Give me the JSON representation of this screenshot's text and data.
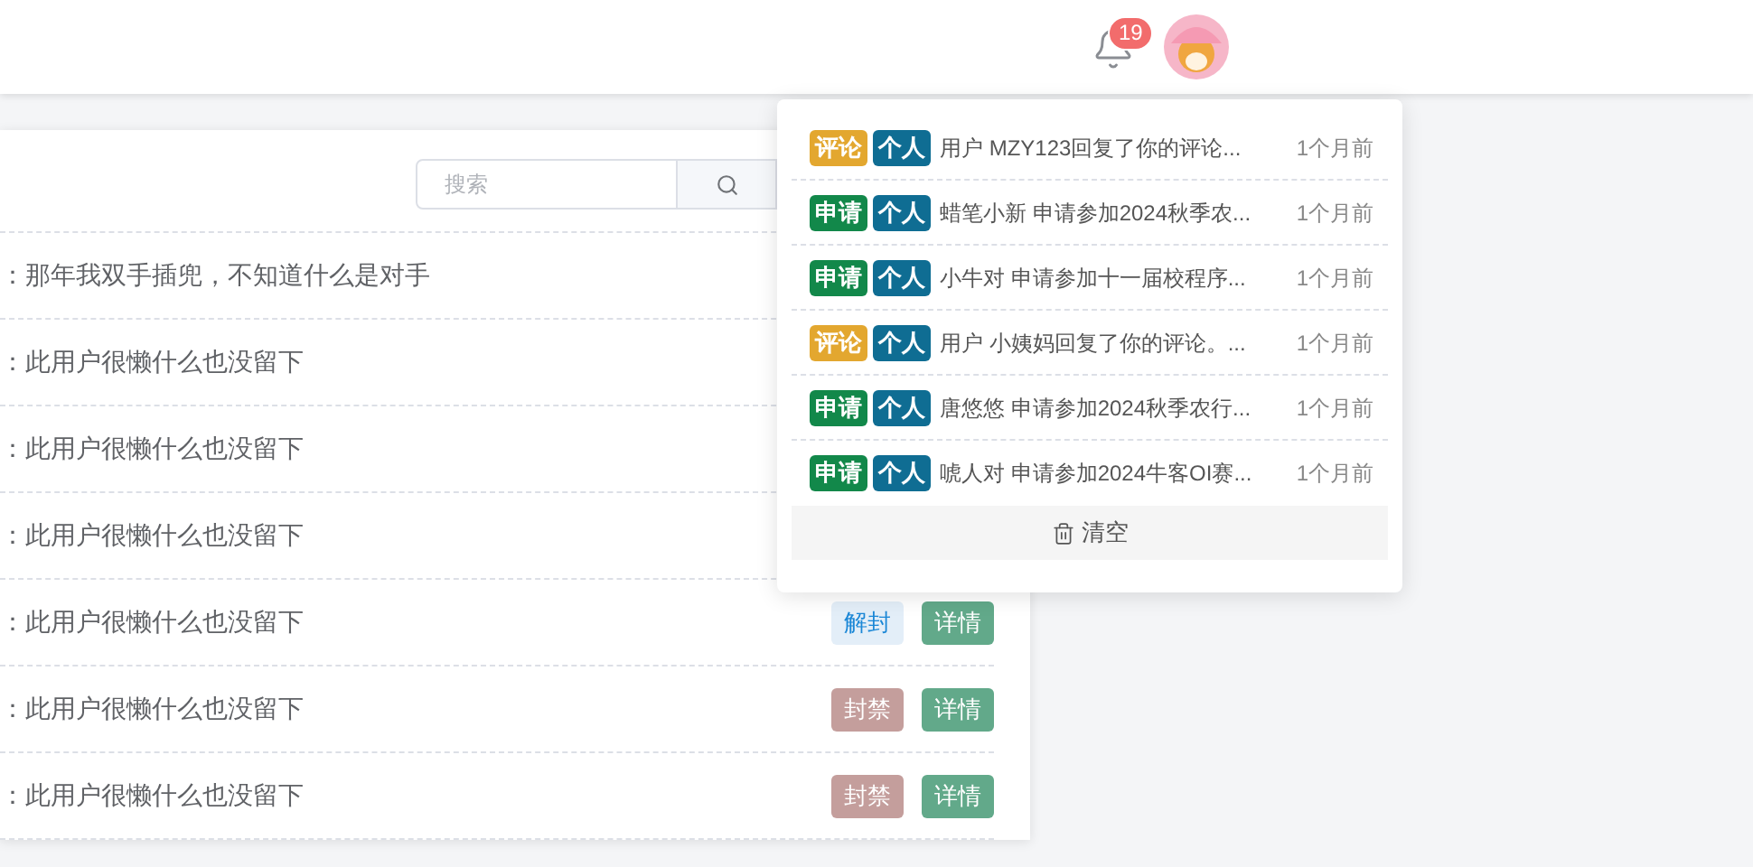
{
  "header": {
    "notification_count": "19"
  },
  "search": {
    "placeholder": "搜索"
  },
  "rows": [
    {
      "bio": "：那年我双手插兜，不知道什么是对手",
      "actions": []
    },
    {
      "bio": "：此用户很懒什么也没留下",
      "actions": []
    },
    {
      "bio": "：此用户很懒什么也没留下",
      "actions": []
    },
    {
      "bio": "：此用户很懒什么也没留下",
      "actions": []
    },
    {
      "bio": "：此用户很懒什么也没留下",
      "actions": [
        {
          "label": "解封",
          "kind": "unban"
        },
        {
          "label": "详情",
          "kind": "detail"
        }
      ]
    },
    {
      "bio": "：此用户很懒什么也没留下",
      "actions": [
        {
          "label": "封禁",
          "kind": "ban"
        },
        {
          "label": "详情",
          "kind": "detail"
        }
      ]
    },
    {
      "bio": "：此用户很懒什么也没留下",
      "actions": [
        {
          "label": "封禁",
          "kind": "ban"
        },
        {
          "label": "详情",
          "kind": "detail"
        }
      ]
    }
  ],
  "notifications": {
    "items": [
      {
        "tags": [
          {
            "label": "评论",
            "color": "#e3a72f"
          },
          {
            "label": "个人",
            "color": "#0f6d93"
          }
        ],
        "text": "用户 MZY123回复了你的评论...",
        "time": "1个月前"
      },
      {
        "tags": [
          {
            "label": "申请",
            "color": "#12884a"
          },
          {
            "label": "个人",
            "color": "#0f6d93"
          }
        ],
        "text": "蜡笔小新 申请参加2024秋季农...",
        "time": "1个月前"
      },
      {
        "tags": [
          {
            "label": "申请",
            "color": "#12884a"
          },
          {
            "label": "个人",
            "color": "#0f6d93"
          }
        ],
        "text": "小牛对 申请参加十一届校程序...",
        "time": "1个月前"
      },
      {
        "tags": [
          {
            "label": "评论",
            "color": "#e3a72f"
          },
          {
            "label": "个人",
            "color": "#0f6d93"
          }
        ],
        "text": "用户 小姨妈回复了你的评论。...",
        "time": "1个月前"
      },
      {
        "tags": [
          {
            "label": "申请",
            "color": "#12884a"
          },
          {
            "label": "个人",
            "color": "#0f6d93"
          }
        ],
        "text": "唐悠悠 申请参加2024秋季农行...",
        "time": "1个月前"
      },
      {
        "tags": [
          {
            "label": "申请",
            "color": "#12884a"
          },
          {
            "label": "个人",
            "color": "#0f6d93"
          }
        ],
        "text": "唬人对 申请参加2024牛客OI赛...",
        "time": "1个月前"
      }
    ],
    "clear_label": "清空"
  }
}
